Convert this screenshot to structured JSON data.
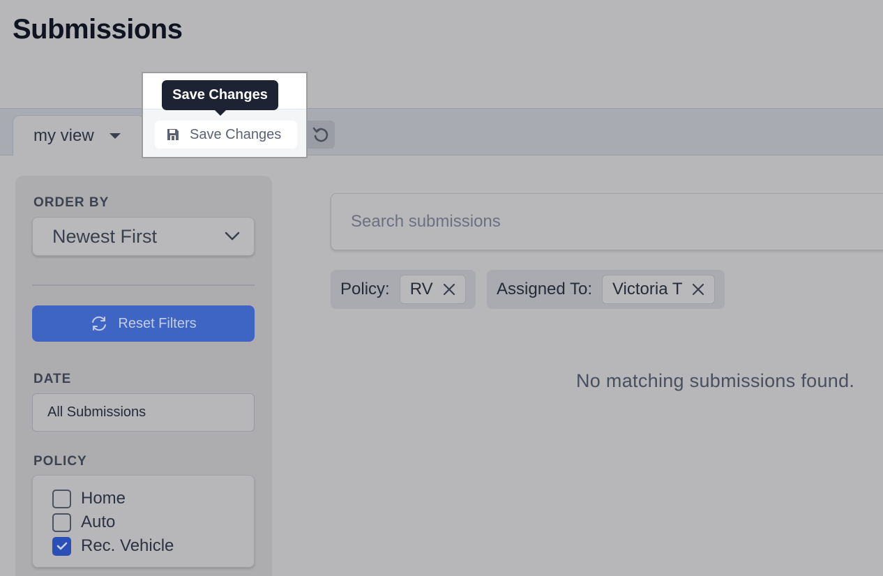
{
  "page": {
    "title": "Submissions"
  },
  "toolbar": {
    "view_label": "my view",
    "save_label": "Save Changes",
    "tooltip": "Save Changes"
  },
  "sidebar": {
    "order_by_label": "ORDER BY",
    "order_by_value": "Newest First",
    "reset_label": "Reset Filters",
    "date_label": "DATE",
    "date_value": "All Submissions",
    "policy_label": "POLICY",
    "policy_options": [
      {
        "label": "Home",
        "checked": false
      },
      {
        "label": "Auto",
        "checked": false
      },
      {
        "label": "Rec. Vehicle",
        "checked": true
      }
    ]
  },
  "search": {
    "placeholder": "Search submissions",
    "value": ""
  },
  "filters": [
    {
      "label": "Policy:",
      "value": "RV"
    },
    {
      "label": "Assigned To:",
      "value": "Victoria T"
    }
  ],
  "main": {
    "empty_message": "No matching submissions found."
  },
  "colors": {
    "accent": "#3e64c4",
    "tooltip_bg": "#1d2333",
    "checkbox_checked": "#2a4fb7"
  },
  "icons": [
    "chevron-down-icon",
    "floppy-disk-icon",
    "undo-icon",
    "refresh-icon",
    "close-icon",
    "check-icon"
  ]
}
